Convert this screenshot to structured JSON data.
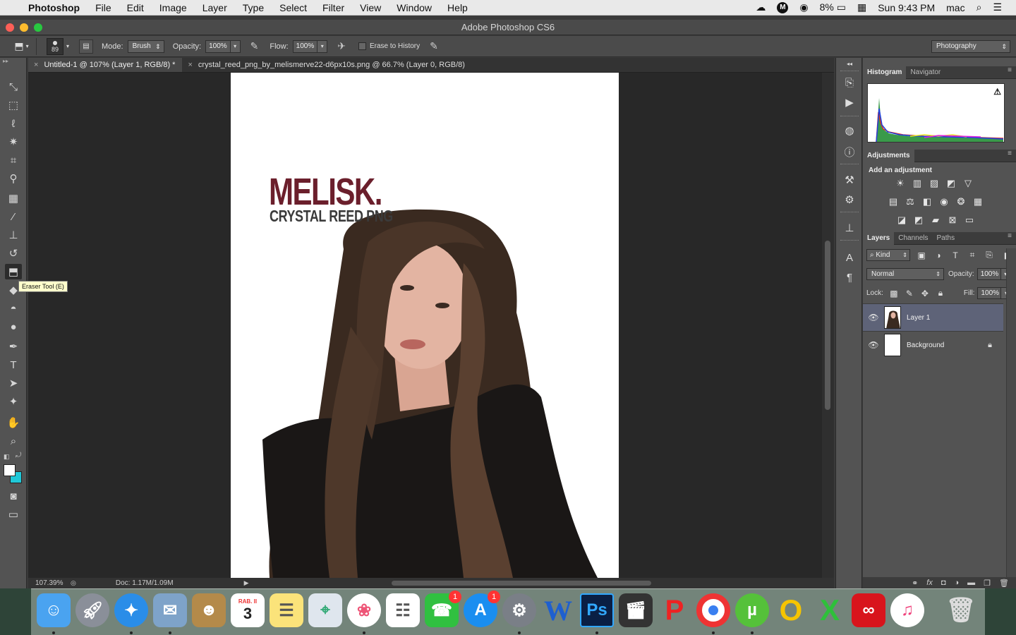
{
  "menubar": {
    "app_name": "Photoshop",
    "items": [
      "File",
      "Edit",
      "Image",
      "Layer",
      "Type",
      "Select",
      "Filter",
      "View",
      "Window",
      "Help"
    ],
    "battery": "8%",
    "clock": "Sun 9:43 PM",
    "user": "mac"
  },
  "window": {
    "title": "Adobe Photoshop CS6"
  },
  "options": {
    "brush_size": "89",
    "mode_label": "Mode:",
    "mode_value": "Brush",
    "opacity_label": "Opacity:",
    "opacity_value": "100%",
    "flow_label": "Flow:",
    "flow_value": "100%",
    "erase_history_label": "Erase to History",
    "workspace": "Photography"
  },
  "tabs": [
    {
      "label": "Untitled-1 @ 107% (Layer 1, RGB/8) *"
    },
    {
      "label": "crystal_reed_png_by_melismerve22-d6px10s.png @ 66.7% (Layer 0, RGB/8)"
    }
  ],
  "tooltip": "Eraser Tool (E)",
  "canvas": {
    "logo_main": "MELISK.",
    "logo_sub": "CRYSTAL REED PNG"
  },
  "status": {
    "zoom": "107.39%",
    "doc_info": "Doc: 1.17M/1.09M"
  },
  "panels": {
    "histogram_tab": "Histogram",
    "navigator_tab": "Navigator",
    "adjustments_tab": "Adjustments",
    "adjustments_title": "Add an adjustment",
    "layers_tab": "Layers",
    "channels_tab": "Channels",
    "paths_tab": "Paths",
    "kind_filter": "Kind",
    "blend_mode": "Normal",
    "opacity_label": "Opacity:",
    "opacity_value": "100%",
    "lock_label": "Lock:",
    "fill_label": "Fill:",
    "fill_value": "100%",
    "layers": [
      {
        "name": "Layer 1",
        "selected": true
      },
      {
        "name": "Background",
        "locked": true
      }
    ]
  },
  "dock": {
    "calendar_month": "RAB. II",
    "calendar_day": "3",
    "facetime_badge": "1",
    "appstore_badge": "1",
    "ps_label": "Ps",
    "word_label": "W"
  },
  "colors": {
    "foreground": "#ffffff",
    "background": "#20c8d8",
    "logo": "#6b1f2c",
    "selected_layer": "#5e6378"
  }
}
